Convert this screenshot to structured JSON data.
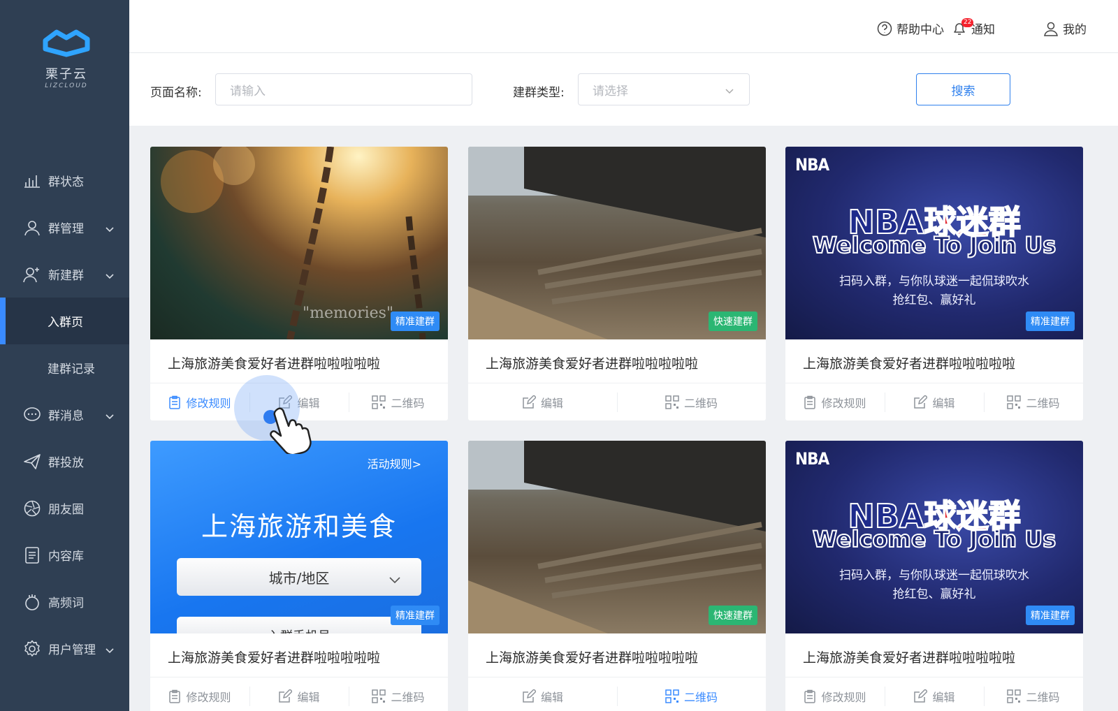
{
  "brand": {
    "name": "栗子云",
    "sub": "LIZCLOUD"
  },
  "sidebar": {
    "items": [
      {
        "label": "群状态",
        "icon": "bar-chart-icon",
        "chevron": false
      },
      {
        "label": "群管理",
        "icon": "user-icon",
        "chevron": true
      },
      {
        "label": "新建群",
        "icon": "user-add-icon",
        "chevron": true
      },
      {
        "label": "入群页",
        "icon": "",
        "chevron": false,
        "active": true
      },
      {
        "label": "建群记录",
        "icon": "",
        "chevron": false
      },
      {
        "label": "群消息",
        "icon": "chat-icon",
        "chevron": true
      },
      {
        "label": "群投放",
        "icon": "send-icon",
        "chevron": false
      },
      {
        "label": "朋友圈",
        "icon": "aperture-icon",
        "chevron": false
      },
      {
        "label": "内容库",
        "icon": "document-icon",
        "chevron": false
      },
      {
        "label": "高频词",
        "icon": "hand-icon",
        "chevron": false
      },
      {
        "label": "用户管理",
        "icon": "gear-icon",
        "chevron": true
      }
    ]
  },
  "topbar": {
    "help": "帮助中心",
    "notify": "通知",
    "notify_badge": "22",
    "mine": "我的"
  },
  "filter": {
    "name_label": "页面名称:",
    "name_placeholder": "请输入",
    "type_label": "建群类型:",
    "type_placeholder": "请选择",
    "search_label": "搜索"
  },
  "cards": [
    {
      "title": "上海旅游美食爱好者进群啦啦啦啦啦",
      "tag": "精准建群",
      "tag_color": "#2f8bf5",
      "image": "swing-chain",
      "image_text": "\"memories\"",
      "actions": [
        "修改规则",
        "编辑",
        "二维码"
      ],
      "highlight": "修改规则"
    },
    {
      "title": "上海旅游美食爱好者进群啦啦啦啦啦",
      "tag": "快速建群",
      "tag_color": "#2bb673",
      "image": "park-bench",
      "actions": [
        "编辑",
        "二维码"
      ]
    },
    {
      "title": "上海旅游美食爱好者进群啦啦啦啦啦",
      "tag": "精准建群",
      "tag_color": "#2f8bf5",
      "image": "nba-poster",
      "actions": [
        "修改规则",
        "编辑",
        "二维码"
      ]
    },
    {
      "title": "上海旅游美食爱好者进群啦啦啦啦啦",
      "tag": "精准建群",
      "tag_color": "#2f8bf5",
      "image": "blue-landing",
      "actions": [
        "修改规则",
        "编辑",
        "二维码"
      ]
    },
    {
      "title": "上海旅游美食爱好者进群啦啦啦啦啦",
      "tag": "快速建群",
      "tag_color": "#2bb673",
      "image": "park-bench",
      "actions": [
        "编辑",
        "二维码"
      ],
      "highlight": "二维码"
    },
    {
      "title": "上海旅游美食爱好者进群啦啦啦啦啦",
      "tag": "精准建群",
      "tag_color": "#2f8bf5",
      "image": "nba-poster",
      "actions": [
        "修改规则",
        "编辑",
        "二维码"
      ]
    }
  ],
  "nba_poster": {
    "logo": "NBA",
    "title_a": "NBA",
    "title_b": "球迷群",
    "subtitle": "Welcome To Join Us",
    "desc_1": "扫码入群，与你队球迷一起侃球吹水",
    "desc_2": "抢红包、赢好礼"
  },
  "blue_landing": {
    "rule_link": "活动规则>",
    "title": "上海旅游和美食",
    "select": "城市/地区",
    "second": "入群手机号"
  }
}
